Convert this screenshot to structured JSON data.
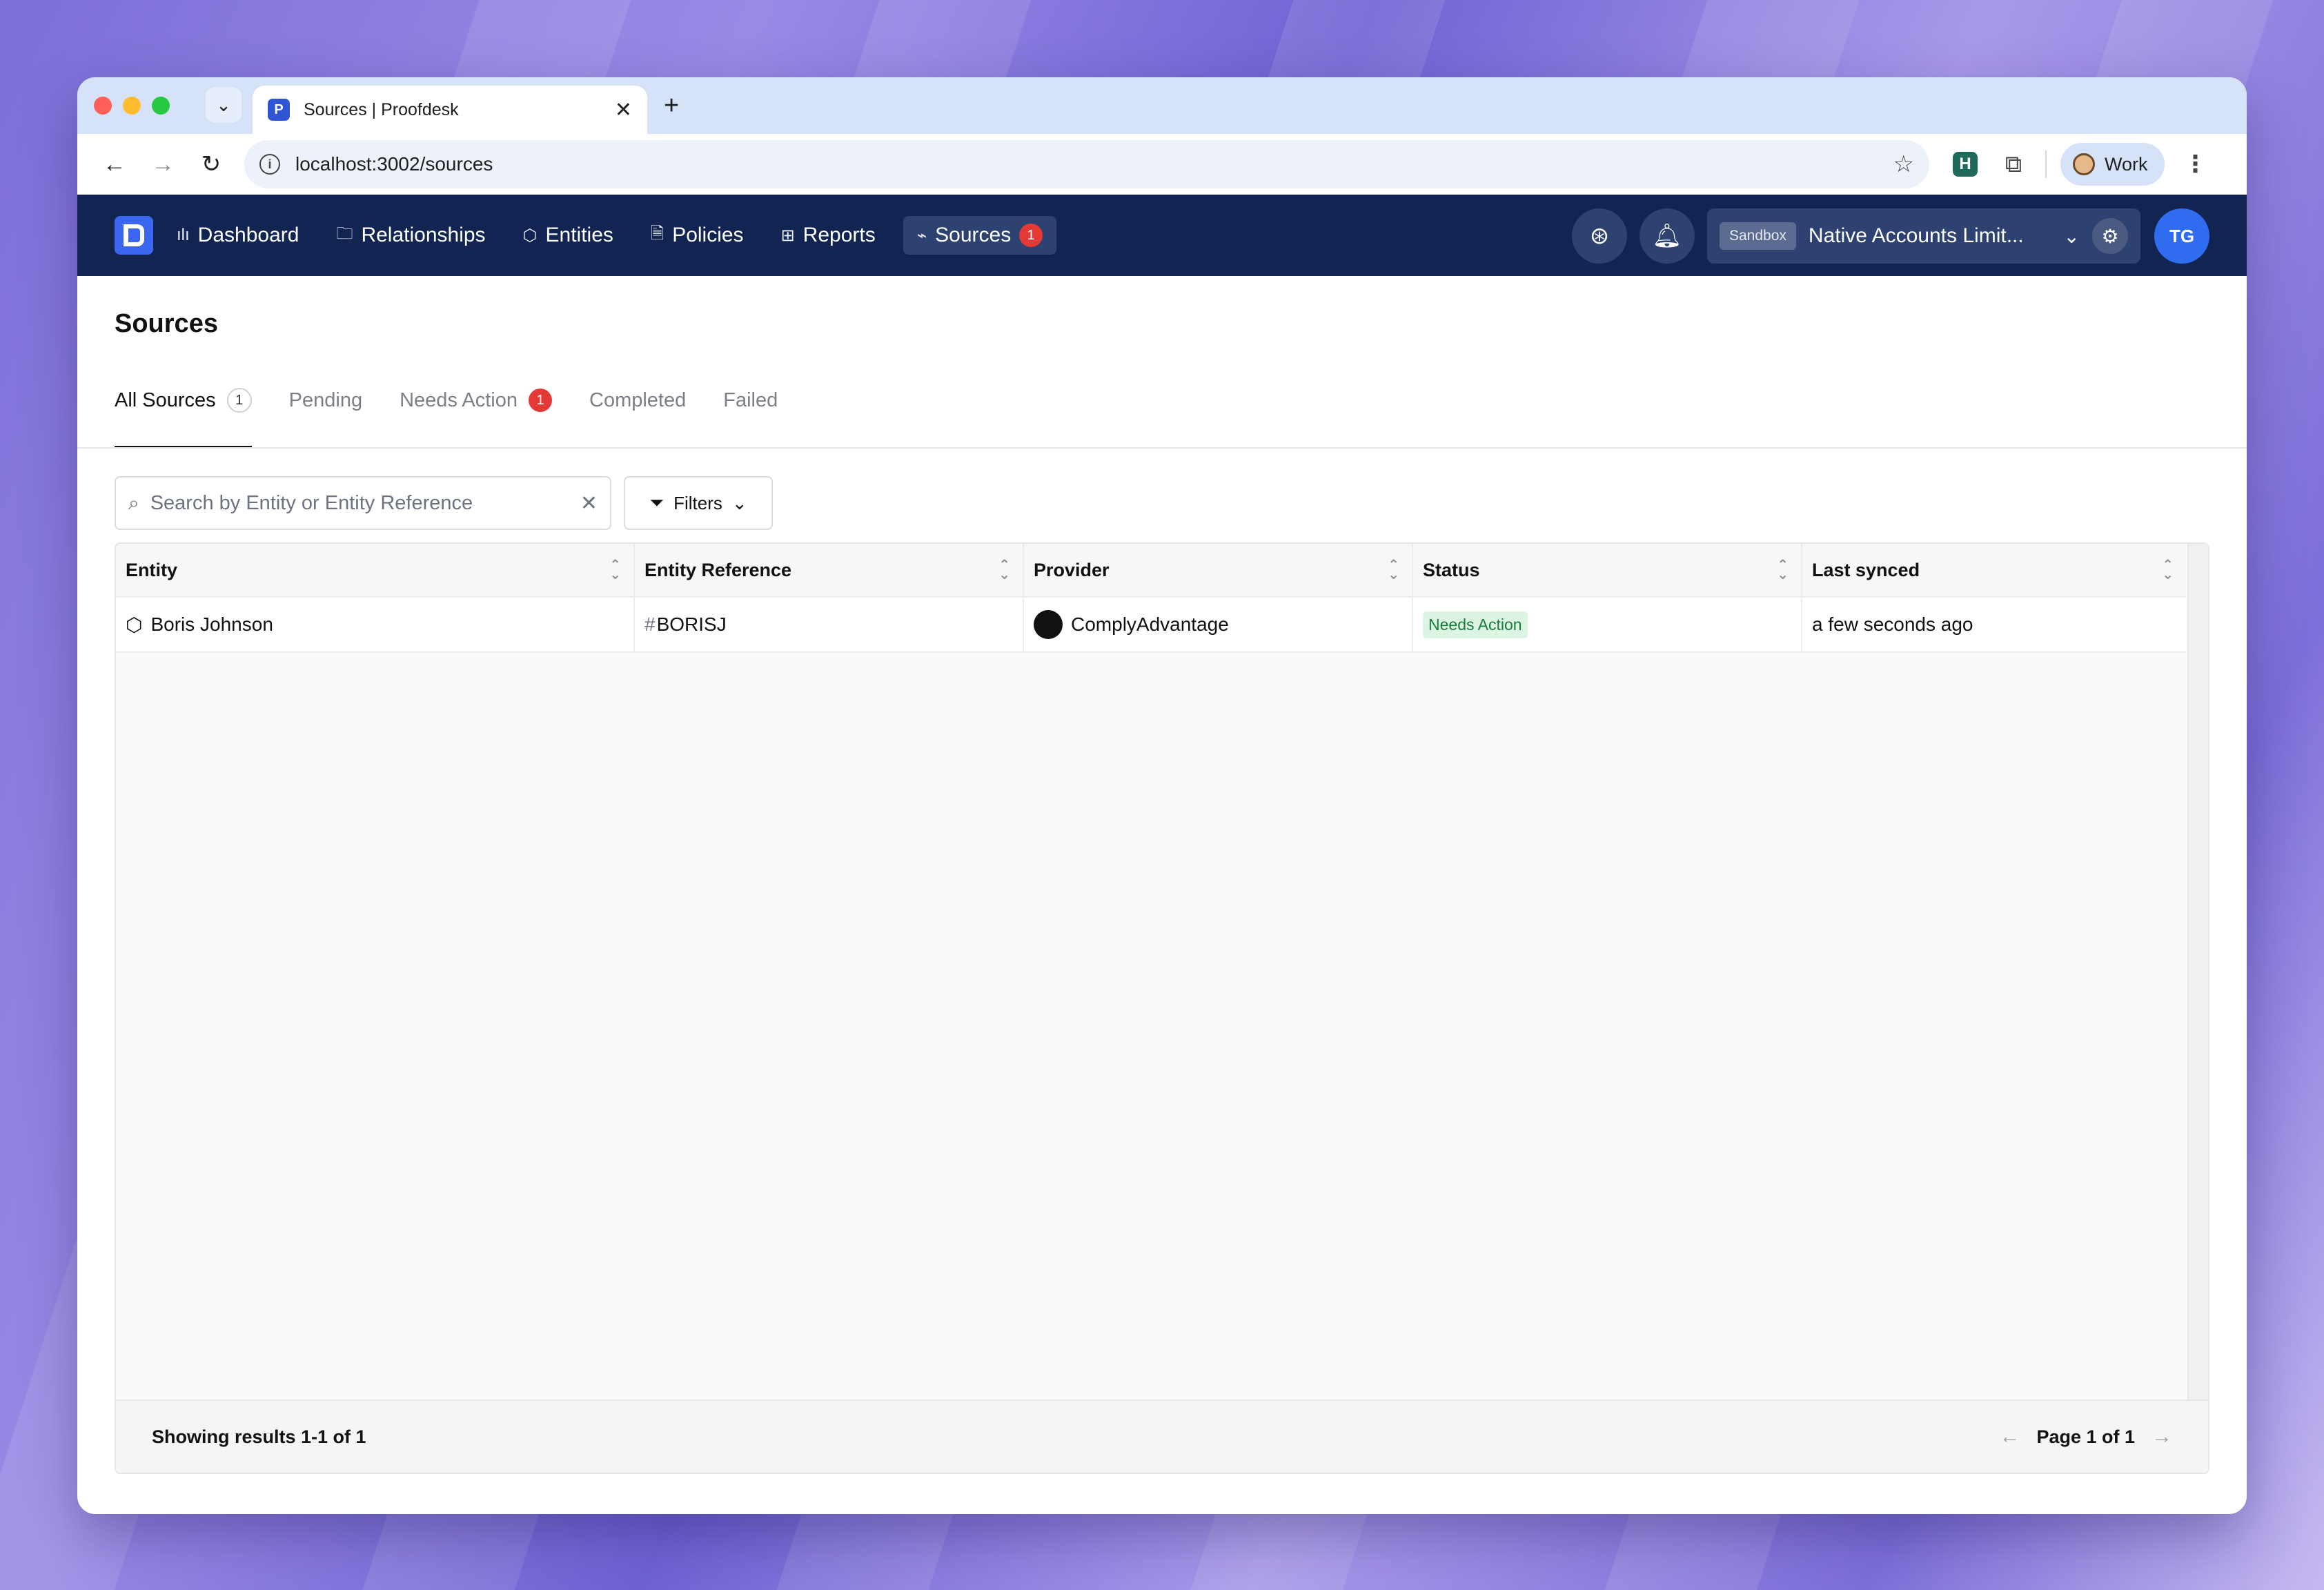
{
  "browser": {
    "tab_title": "Sources | Proofdesk",
    "url": "localhost:3002/sources",
    "profile_label": "Work"
  },
  "appnav": {
    "items": [
      {
        "label": "Dashboard",
        "icon": "bar-chart-icon"
      },
      {
        "label": "Relationships",
        "icon": "folder-icon"
      },
      {
        "label": "Entities",
        "icon": "cube-icon"
      },
      {
        "label": "Policies",
        "icon": "document-icon"
      },
      {
        "label": "Reports",
        "icon": "table-icon"
      },
      {
        "label": "Sources",
        "icon": "rss-icon",
        "badge": "1",
        "active": true
      }
    ],
    "environment_badge": "Sandbox",
    "organization": "Native Accounts Limit...",
    "avatar_initials": "TG"
  },
  "page": {
    "title": "Sources",
    "tabs": [
      {
        "label": "All Sources",
        "count": "1",
        "active": true
      },
      {
        "label": "Pending"
      },
      {
        "label": "Needs Action",
        "badge": "1"
      },
      {
        "label": "Completed"
      },
      {
        "label": "Failed"
      }
    ],
    "search_placeholder": "Search by Entity or Entity Reference",
    "filters_label": "Filters"
  },
  "table": {
    "columns": [
      "Entity",
      "Entity Reference",
      "Provider",
      "Status",
      "Last synced"
    ],
    "rows": [
      {
        "entity": "Boris Johnson",
        "reference_hash": "#",
        "reference": "BORISJ",
        "provider": "ComplyAdvantage",
        "status": "Needs Action",
        "last_synced": "a few seconds ago"
      }
    ],
    "footer_results": "Showing results 1-1 of 1",
    "footer_page": "Page 1 of 1"
  },
  "colors": {
    "nav_bg": "#122552",
    "accent": "#3a66f0",
    "badge_red": "#e53935",
    "status_green_bg": "#dcf5e3",
    "status_green_text": "#1a7a3a"
  }
}
